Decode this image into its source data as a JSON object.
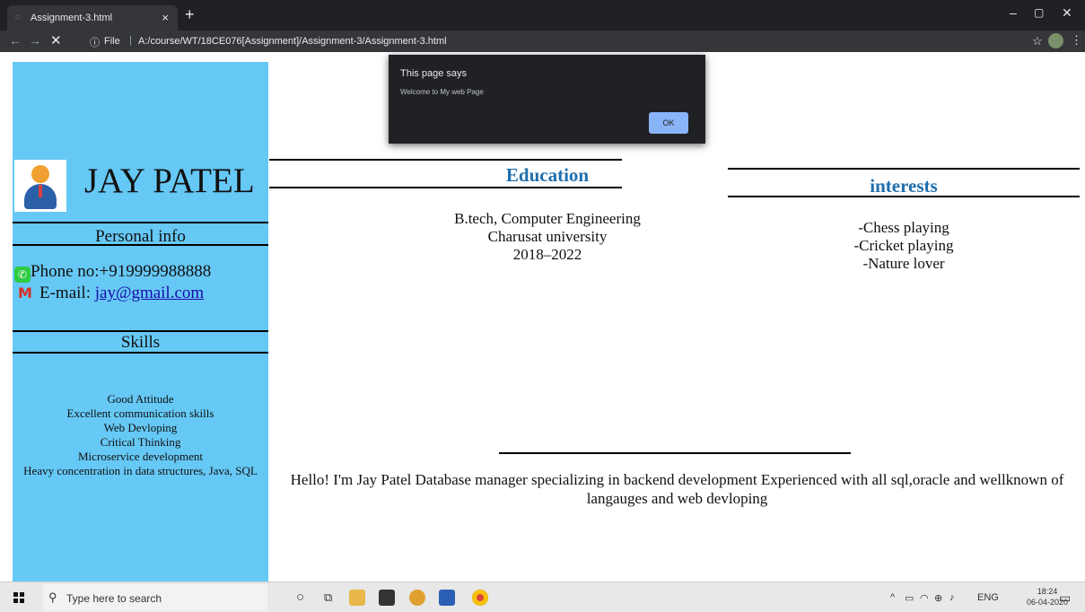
{
  "browser": {
    "tab_title": "Assignment-3.html",
    "tab_close": "×",
    "new_tab": "+",
    "url_scheme": "File",
    "url_separator": "|",
    "url": "A:/course/WT/18CE076[Assignment]/Assignment-3/Assignment-3.html",
    "icons": [
      "back-icon",
      "forward-icon",
      "stop-icon",
      "info-icon",
      "star-icon",
      "profile-icon",
      "menu-icon"
    ]
  },
  "dialog": {
    "title": "This page says",
    "message": "Welcome to My web Page",
    "ok_label": "OK"
  },
  "profile": {
    "name": "JAY PATEL",
    "personal_info_title": "Personal info",
    "phone": "Phone no:+919999988888",
    "email_label": "E-mail: ",
    "email": "jay@gmail.com",
    "skills_title": "Skills",
    "skills": [
      "Good Attitude",
      "Excellent communication skills",
      "Web Devloping",
      "Critical Thinking",
      "Microservice development",
      "Heavy concentration in data structures, Java, SQL"
    ]
  },
  "education": {
    "title": "Education",
    "lines": [
      "B.tech, Computer Engineering",
      "Charusat university",
      "2018–2022"
    ]
  },
  "interests": {
    "title": "interests",
    "lines": [
      "-Chess playing",
      "-Cricket playing",
      "-Nature lover"
    ]
  },
  "about": "Hello! I'm Jay Patel Database manager specializing in backend development Experienced with all sql,oracle and wellknown of langauges and web devloping",
  "taskbar": {
    "search_placeholder": "Type here to search",
    "language": "ENG",
    "time": "18:24",
    "date": "06-04-2020"
  },
  "colors": {
    "sidebar": "#66c8f5",
    "heading": "#1f6fae",
    "dialog_bg": "#202124",
    "ok_button": "#8ab4f8"
  }
}
